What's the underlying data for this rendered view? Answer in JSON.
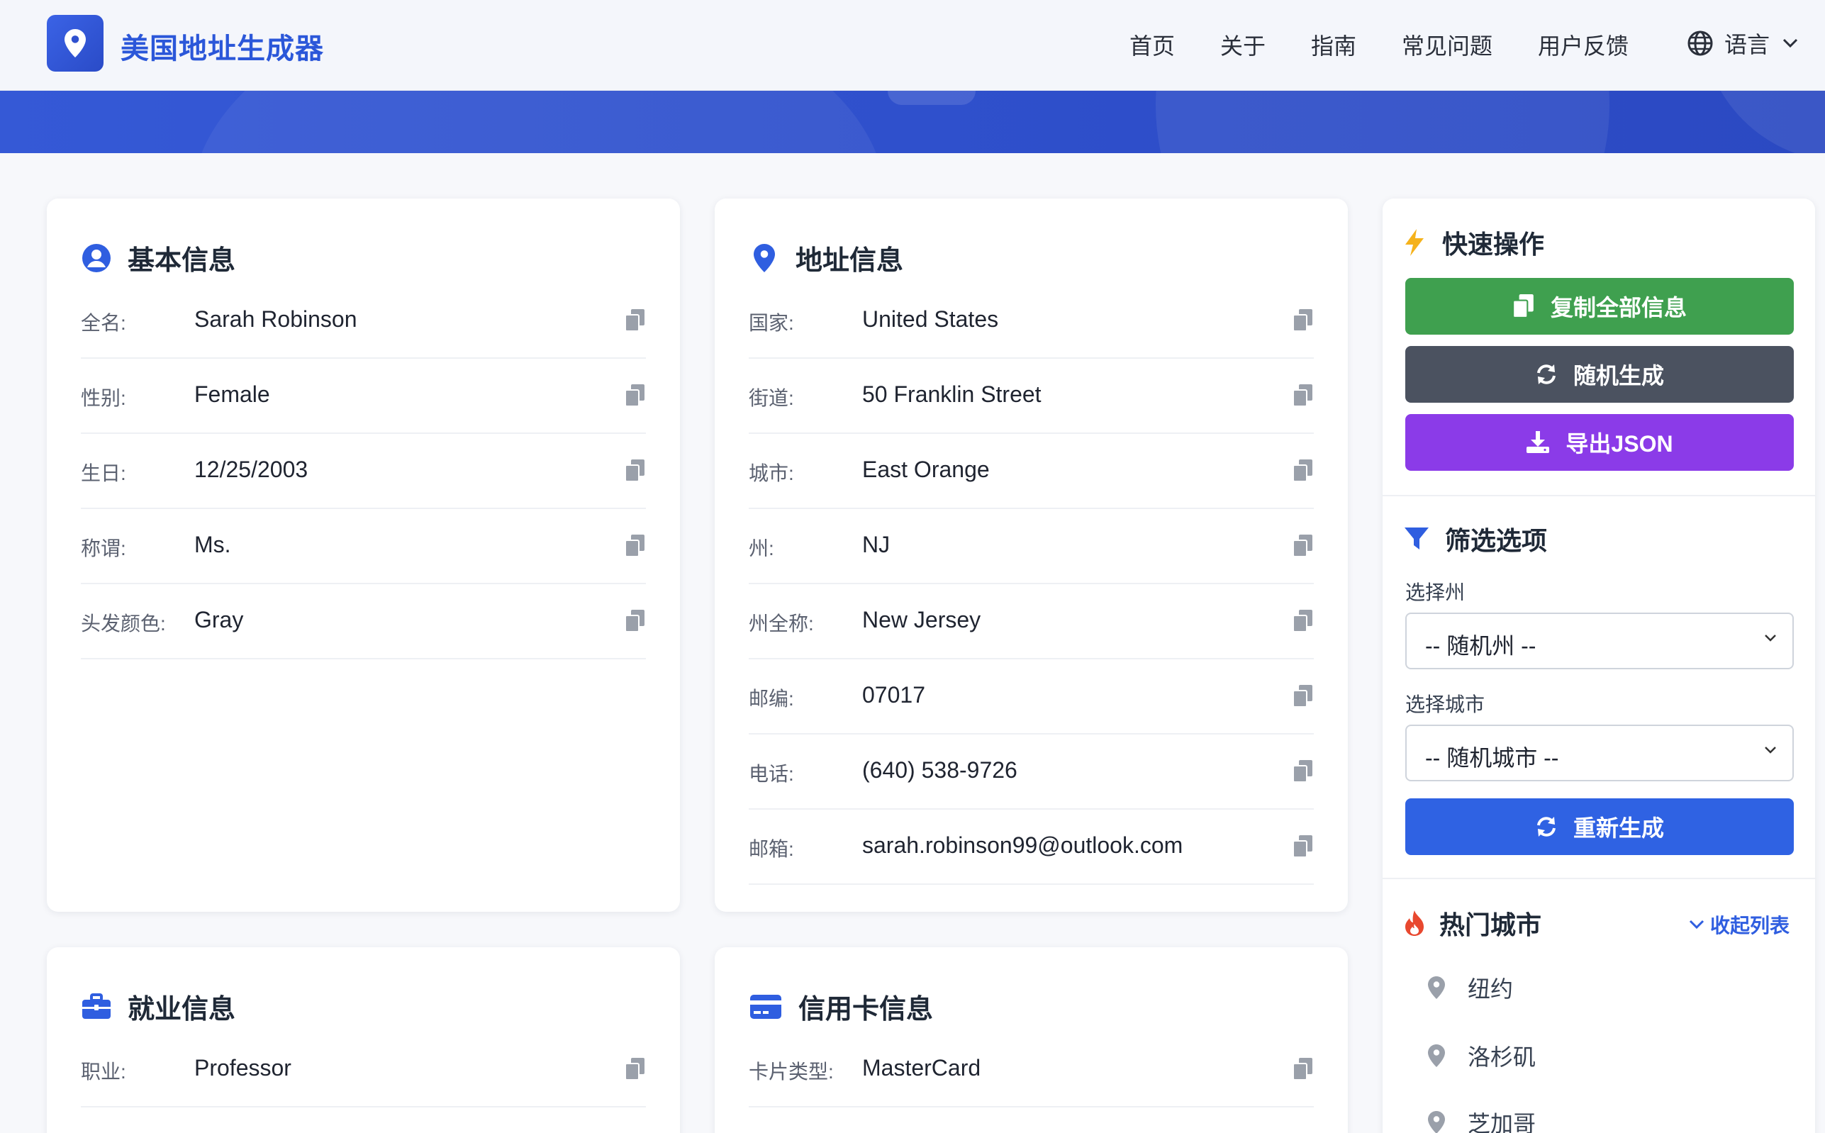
{
  "header": {
    "title": "美国地址生成器",
    "nav": [
      "首页",
      "关于",
      "指南",
      "常见问题",
      "用户反馈"
    ],
    "language_label": "语言"
  },
  "basic": {
    "title": "基本信息",
    "rows": [
      {
        "label": "全名:",
        "value": "Sarah Robinson"
      },
      {
        "label": "性别:",
        "value": "Female"
      },
      {
        "label": "生日:",
        "value": "12/25/2003"
      },
      {
        "label": "称谓:",
        "value": "Ms."
      },
      {
        "label": "头发颜色:",
        "value": "Gray"
      }
    ]
  },
  "address": {
    "title": "地址信息",
    "rows": [
      {
        "label": "国家:",
        "value": "United States"
      },
      {
        "label": "街道:",
        "value": "50 Franklin Street"
      },
      {
        "label": "城市:",
        "value": "East Orange"
      },
      {
        "label": "州:",
        "value": "NJ"
      },
      {
        "label": "州全称:",
        "value": "New Jersey"
      },
      {
        "label": "邮编:",
        "value": "07017"
      },
      {
        "label": "电话:",
        "value": "(640) 538-9726"
      },
      {
        "label": "邮箱:",
        "value": "sarah.robinson99@outlook.com"
      }
    ]
  },
  "employment": {
    "title": "就业信息",
    "rows": [
      {
        "label": "职业:",
        "value": "Professor"
      }
    ]
  },
  "credit_card": {
    "title": "信用卡信息",
    "rows": [
      {
        "label": "卡片类型:",
        "value": "MasterCard"
      }
    ]
  },
  "sidebar": {
    "quick_title": "快速操作",
    "copy_all": "复制全部信息",
    "random": "随机生成",
    "export": "导出JSON",
    "filter_title": "筛选选项",
    "state_label": "选择州",
    "state_value": "-- 随机州 --",
    "city_label": "选择城市",
    "city_value": "-- 随机城市 --",
    "regenerate": "重新生成",
    "hot_title": "热门城市",
    "collapse": "收起列表",
    "cities": [
      "纽约",
      "洛杉矶",
      "芝加哥"
    ]
  },
  "colors": {
    "primary": "#2f5ee0",
    "green": "#3fa04f",
    "dark": "#4b5260",
    "purple": "#8b3be8",
    "blue_btn": "#2f62e3"
  }
}
